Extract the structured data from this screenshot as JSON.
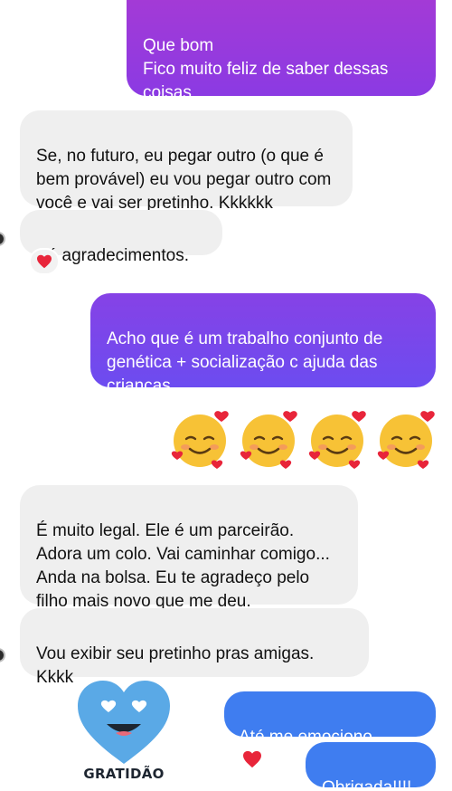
{
  "messages": {
    "m1": "Que bom\nFico muito feliz de saber dessas coisas",
    "m2": "Se, no futuro, eu pegar outro (o que é bem provável) eu vou pegar outro com você e vai ser pretinho. Kkkkkk",
    "m3": "Só agradecimentos.",
    "m4": "Acho que é um trabalho conjunto de genética + socialização c ajuda das crianças",
    "m5": "É muito legal. Ele é um parceirão. Adora um colo. Vai caminhar comigo... Anda na bolsa. Eu te agradeço pelo filho mais novo que me deu.",
    "m6": "Vou  exibir seu pretinho pras amigas. Kkkk",
    "m7": "Até me emociono",
    "m8": "Obrigada!!!!"
  },
  "reaction": {
    "icon": "red-heart-icon"
  },
  "emoji_row": {
    "icon": "smiling-face-with-hearts-icon",
    "count": 4
  },
  "sticker": {
    "label": "GRATIDÃO",
    "icon": "heart-eyes-heart-sticker"
  },
  "colors": {
    "incoming_bg": "#efefef",
    "outgoing_purple": "#a33ad6",
    "outgoing_violet": "#7a46ea",
    "outgoing_blue": "#3f7df0",
    "heart_red": "#e8253a",
    "sticker_blue": "#5aa9e6"
  }
}
